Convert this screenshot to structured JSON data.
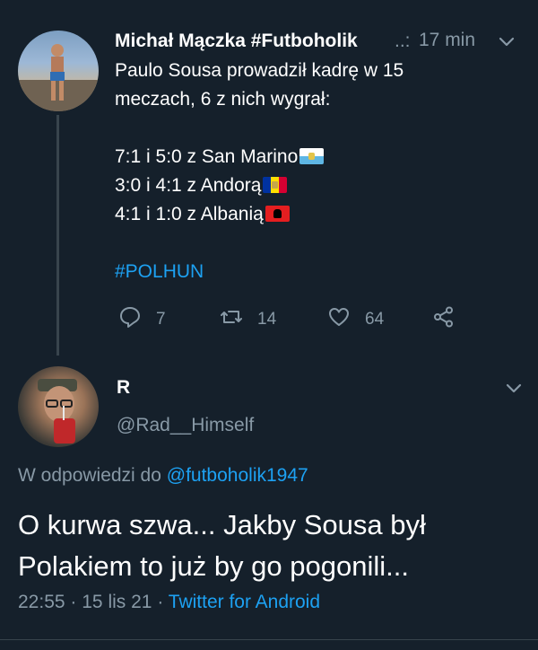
{
  "tweet1": {
    "author": "Michał Mączka #Futboholik",
    "dots": "..:",
    "time": "17 min",
    "lines": [
      "Paulo Sousa prowadził kadrę w 15",
      "meczach, 6 z nich wygrał:"
    ],
    "results": [
      {
        "text": "7:1 i 5:0 z San Marino",
        "flag": "san-marino-flag"
      },
      {
        "text": "3:0 i 4:1 z Andorą",
        "flag": "andorra-flag"
      },
      {
        "text": "4:1 i 1:0 z Albanią",
        "flag": "albania-flag"
      }
    ],
    "hashtag": "#POLHUN",
    "replies": "7",
    "retweets": "14",
    "likes": "64"
  },
  "tweet2": {
    "author": "R",
    "handle": "@Rad__Himself",
    "reply_prefix": "W odpowiedzi do",
    "reply_to": "@futboholik1947",
    "text": "O kurwa szwa... Jakby Sousa był Polakiem to już by go pogonili...",
    "time": "22:55",
    "sep1": "·",
    "date": "15 lis 21",
    "sep2": "·",
    "client": "Twitter for Android"
  },
  "colors": {
    "background": "#15202b",
    "secondary_text": "#8899a6",
    "link": "#1da1f2",
    "divider": "#38444d"
  }
}
